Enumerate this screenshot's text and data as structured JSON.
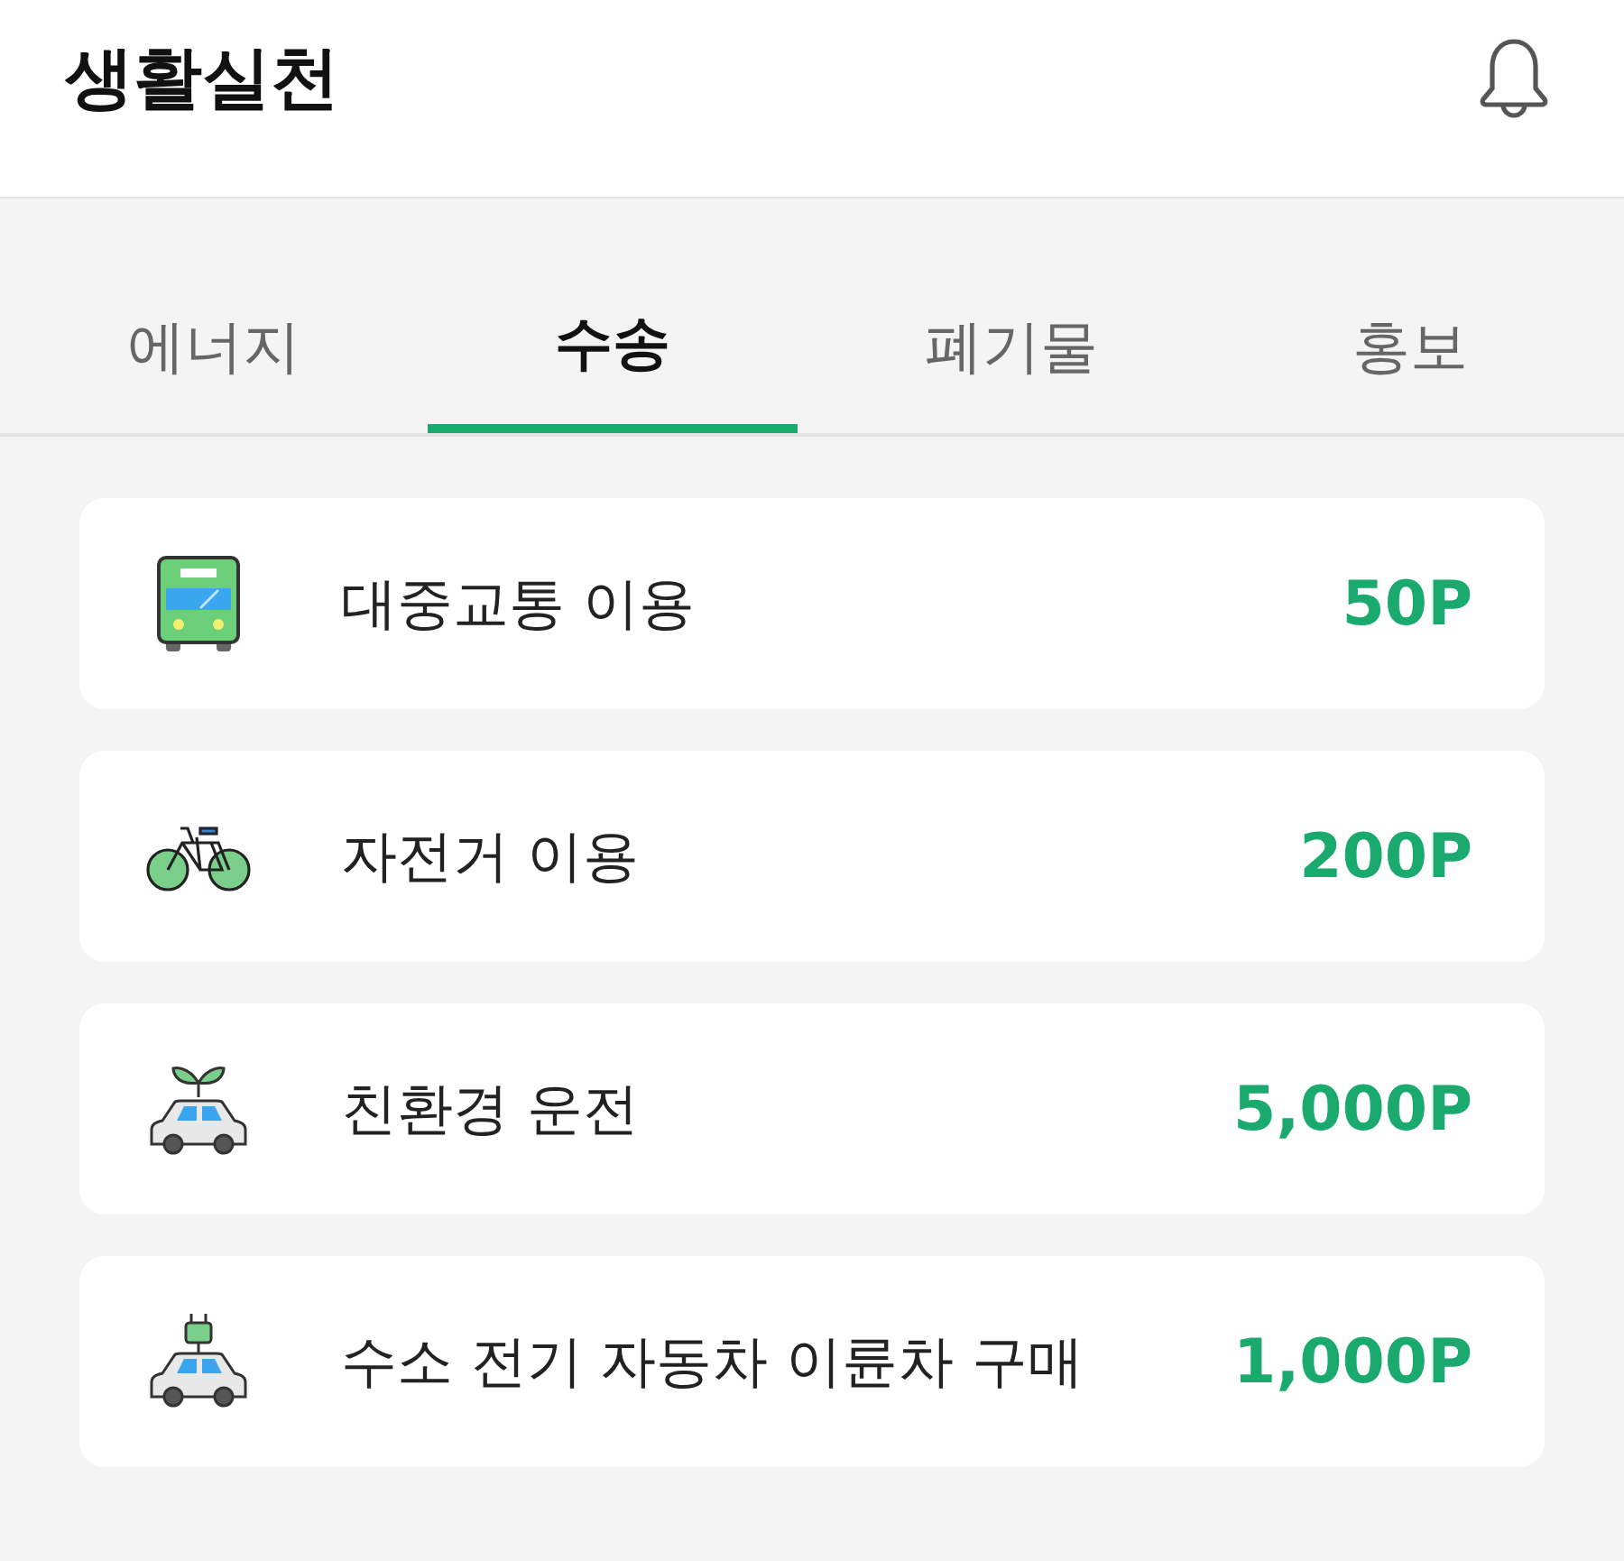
{
  "header": {
    "title": "생활실천"
  },
  "tabs": [
    {
      "label": "에너지",
      "selected": false
    },
    {
      "label": "수송",
      "selected": true
    },
    {
      "label": "폐기물",
      "selected": false
    },
    {
      "label": "홍보",
      "selected": false
    }
  ],
  "items": [
    {
      "kind": "bus",
      "label": "대중교통 이용",
      "points": "50P"
    },
    {
      "kind": "bicycle",
      "label": "자전거 이용",
      "points": "200P"
    },
    {
      "kind": "eco-car",
      "label": "친환경 운전",
      "points": "5,000P"
    },
    {
      "kind": "plug-car",
      "label": "수소 전기 자동차 이륜차 구매",
      "points": "1,000P"
    }
  ]
}
